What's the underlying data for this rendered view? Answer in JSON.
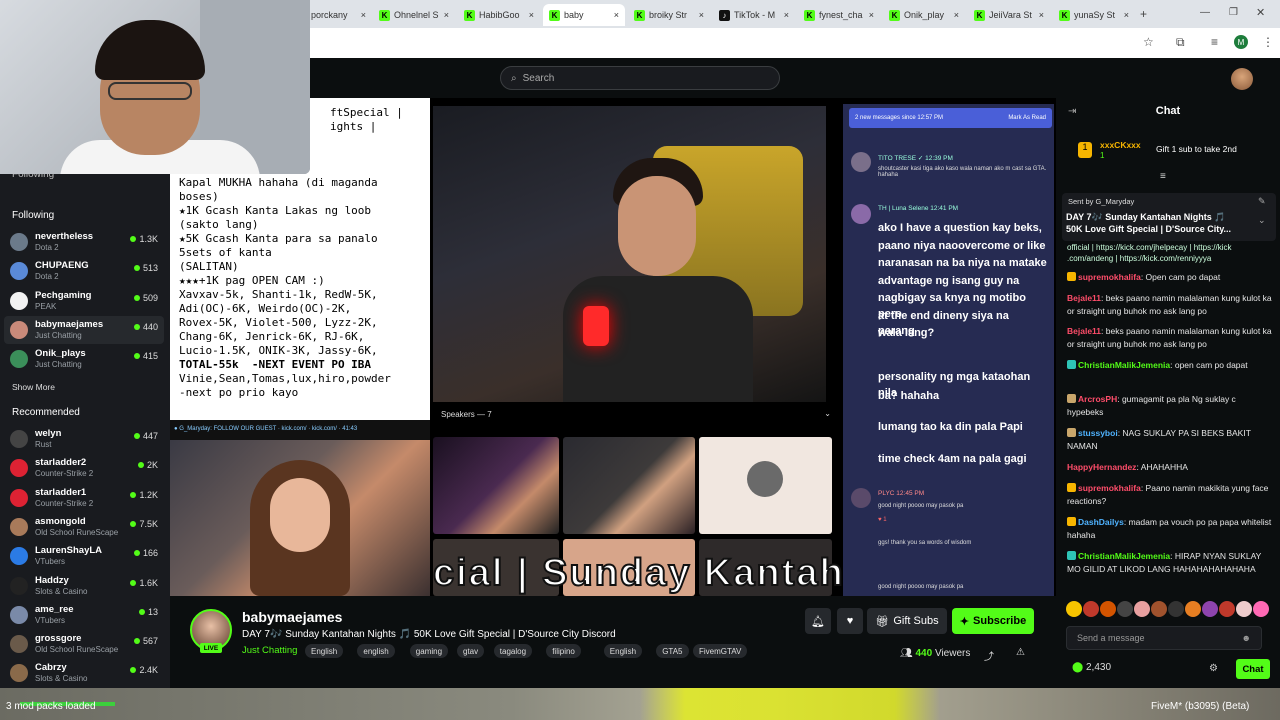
{
  "browser": {
    "tabs": [
      {
        "label": "porckany",
        "icon": "kick"
      },
      {
        "label": "Ohnelnel S",
        "icon": "kick"
      },
      {
        "label": "HabibGoo",
        "icon": "kick"
      },
      {
        "label": "baby",
        "icon": "kick",
        "active": true
      },
      {
        "label": "broiky Str",
        "icon": "kick"
      },
      {
        "label": "TikTok - M",
        "icon": "tiktok"
      },
      {
        "label": "fynest_cha",
        "icon": "kick"
      },
      {
        "label": "Onik_play",
        "icon": "kick"
      },
      {
        "label": "JeiiVara St",
        "icon": "kick"
      },
      {
        "label": "yunaSy St",
        "icon": "kick"
      }
    ],
    "profile_initial": "M"
  },
  "header": {
    "search_placeholder": "Search"
  },
  "sidebar": {
    "following_heading": "Following",
    "following_top_cut": "Following",
    "following": [
      {
        "name": "nevertheless",
        "category": "Dota 2",
        "viewers": "1.3K",
        "color": "#6b7a8a"
      },
      {
        "name": "CHUPAENG",
        "category": "Dota 2",
        "viewers": "513",
        "color": "#5a8ad8"
      },
      {
        "name": "Pechgaming",
        "category": "PEAK",
        "viewers": "509",
        "color": "#f2f2f2"
      },
      {
        "name": "babymaejames",
        "category": "Just Chatting",
        "viewers": "440",
        "color": "#c98a7a",
        "active": true
      },
      {
        "name": "Onik_plays",
        "category": "Just Chatting",
        "viewers": "415",
        "color": "#3b8f5a"
      }
    ],
    "show_more": "Show More",
    "recommended_heading": "Recommended",
    "recommended": [
      {
        "name": "welyn",
        "category": "Rust",
        "viewers": "447",
        "color": "#444"
      },
      {
        "name": "starladder2",
        "category": "Counter-Strike 2",
        "viewers": "2K",
        "color": "#d23"
      },
      {
        "name": "starladder1",
        "category": "Counter-Strike 2",
        "viewers": "1.2K",
        "color": "#d23"
      },
      {
        "name": "asmongold",
        "category": "Old School RuneScape",
        "viewers": "7.5K",
        "color": "#a87a5a"
      },
      {
        "name": "LaurenShayLA",
        "category": "VTubers",
        "viewers": "166",
        "color": "#2b7be5"
      },
      {
        "name": "Haddzy",
        "category": "Slots & Casino",
        "viewers": "1.6K",
        "color": "#222"
      },
      {
        "name": "ame_ree",
        "category": "VTubers",
        "viewers": "13",
        "color": "#7a8aa8"
      },
      {
        "name": "grossgore",
        "category": "Old School RuneScape",
        "viewers": "567",
        "color": "#6a5a4a"
      },
      {
        "name": "Cabrzy",
        "category": "Slots & Casino",
        "viewers": "2.4K",
        "color": "#8a6a4a"
      }
    ]
  },
  "stream_overlay": {
    "notes": [
      "ftSpecial |",
      "ights |",
      "as Loob or",
      "Kapal MUKHA hahaha (di maganda",
      "boses)",
      "★1K Gcash Kanta Lakas ng loob",
      "(sakto lang)",
      "★5K Gcash Kanta para sa panalo",
      "5sets of kanta",
      "(SALITAN)",
      "★★★+1K pag OPEN CAM :)",
      "Xavxav-5k, Shanti-1k, RedW-5K,",
      "Adi(OC)-6K, Weirdo(OC)-2K,",
      "Rovex-5K, Violet-500, Lyzz-2K,",
      "Chang-6K, Jenrick-6K, RJ-6K,",
      "Lucio-1.5K, ONIK-3K, Jassy-6K,",
      "TOTAL-55k  -NEXT EVENT PO IBA",
      "Vinie,Sean,Tomas,lux,hiro,powder",
      "-next po prio kayo"
    ],
    "speakers_label": "Speakers — 7",
    "banner": "cial | Sunday Kantaha",
    "chat": {
      "new_messages": "2 new messages since 12:57 PM",
      "mark_read": "Mark As Read",
      "msg1_name": "TITO TRESE ✓ 12:39 PM",
      "msg1_text": "shoutcaster kasi tiga ako kaso wala naman ako m cast sa GTA. hahaha",
      "msg2_name": "TH | Luna Selene 12:41 PM",
      "msg2_lines": [
        "ako I have a question kay beks,",
        "paano niya naoovercome or like",
        "naranasan na ba niya na matake",
        "advantage ng isang guy na",
        "nagbigay sa knya ng motibo pero",
        "at the end dineny siya na parang",
        "wala lang?"
      ],
      "msg3_lines": [
        "personality ng mga kataohan nila",
        "ba? hahaha"
      ],
      "msg4": "lumang tao ka din pala Papi",
      "msg5": "time check 4am na pala gagi",
      "msg6_name": "PLYC 12:45 PM",
      "msg6_text": "good night poooo may pasok pa",
      "msg7_text": "ggs! thank you sa words of wisdom",
      "msg8_text": "good night poooo may pasok pa"
    }
  },
  "stream_info": {
    "channel": "babymaejames",
    "live": "LIVE",
    "title": "DAY 7🎶 Sunday Kantahan Nights 🎵 50K Love Gift Special | D'Source City Discord",
    "category": "Just Chatting",
    "tags": [
      "English",
      "english",
      "gaming",
      "gtav",
      "tagalog",
      "filipino",
      "English",
      "GTA5",
      "FivemGTAV"
    ],
    "gift_subs": "Gift Subs",
    "subscribe": "Subscribe",
    "viewers_count": "440",
    "viewers_label": "Viewers"
  },
  "chat": {
    "title": "Chat",
    "gift_user": "xxxCKxxx",
    "gift_count": "1",
    "gift_cta": "Gift 1 sub to take 2nd",
    "pinned_sender": "Sent by G_Maryday",
    "pinned_text": "DAY 7🎶 Sunday Kantahan Nights 🎵 50K Love Gift Special | D'Source City...",
    "partial_link_1": "official | https://kick.com/jhelpecay | https://kick",
    "partial_link_2": ".com/andeng | https://kick.com/renniyyya",
    "messages": [
      {
        "user": "supremokhalifa",
        "text": ": Open cam po dapat",
        "color": "#ff4d6a",
        "badge": "#f7b500"
      },
      {
        "user": "Bejale11",
        "text": ": beks paano namin malalaman kung kulot ka or straight ung buhok mo ask lang po",
        "color": "#ff4d6a",
        "badge": ""
      },
      {
        "user": "Bejale11",
        "text": ": beks paano namin malalaman kung kulot ka or straight ung buhok mo ask lang po",
        "color": "#ff4d6a",
        "badge": ""
      },
      {
        "user": "ChristianMalikJemenia",
        "text": ": open cam po dapat",
        "color": "#53fc18",
        "badge": "#2ec4b6"
      },
      {
        "user": "ArcrosPH",
        "text": ": gumagamit pa pla Ng suklay c hypebeks",
        "color": "#ff4d6a",
        "badge": "#c9a66b"
      },
      {
        "user": "stussyboi",
        "text": ": NAG SUKLAY PA SI BEKS BAKIT NAMAN",
        "color": "#4fb3ff",
        "badge": "#c9a66b"
      },
      {
        "user": "HappyHernandez",
        "text": ": AHAHAHHA",
        "color": "#ff4d6a",
        "badge": ""
      },
      {
        "user": "supremokhalifa",
        "text": ": Paano namin makikita yung face reactions?",
        "color": "#ff4d6a",
        "badge": "#f7b500"
      },
      {
        "user": "DashDailys",
        "text": ": madam pa vouch po pa papa whitelist hahaha",
        "color": "#4fb3ff",
        "badge": "#f7b500"
      },
      {
        "user": "ChristianMalikJemenia",
        "text": ": HIRAP NYAN SUKLAY MO GILID AT LIKOD LANG HAHAHAHAHAHAHA",
        "color": "#53fc18",
        "badge": "#2ec4b6"
      }
    ],
    "input_placeholder": "Send a message",
    "points": "2,430",
    "send": "Chat"
  },
  "game_hud": {
    "mod_text": "3 mod packs loaded",
    "fivem": "FiveM* (b3095) (Beta)"
  },
  "colors": {
    "accent": "#53fc18",
    "bg": "#0b0e0f",
    "panel": "#191b1f"
  }
}
